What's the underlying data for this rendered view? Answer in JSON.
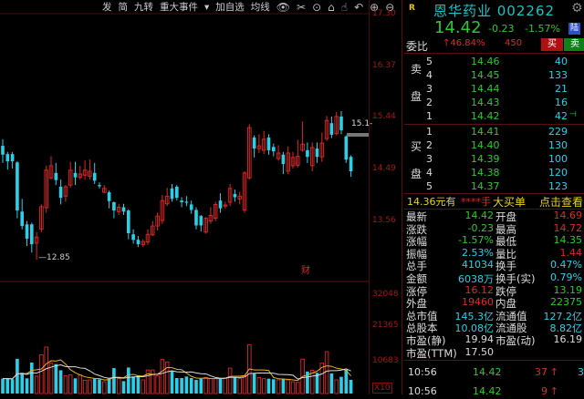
{
  "toolbar": {
    "items": [
      "发",
      "简",
      "九转",
      "重大事件",
      "▾",
      "加自选",
      "均线"
    ],
    "icons": [
      "eye-icon",
      "scissors-icon",
      "play-icon",
      "lock-icon",
      "hand-icon",
      "undo-icon",
      "zoom-in-icon",
      "zoom-out-icon"
    ]
  },
  "chart_data": {
    "type": "candlestick",
    "price_axis": [
      "17.30",
      "16.37",
      "15.44",
      "14.49",
      "13.56"
    ],
    "ylim": [
      12.6,
      17.3
    ],
    "low_label": "12.85",
    "high_label": "15.1-",
    "event_marker": "财",
    "candles": [
      [
        14.91,
        14.75,
        15.03,
        14.6
      ],
      [
        14.76,
        14.63,
        14.8,
        14.48
      ],
      [
        14.76,
        14.63,
        14.8,
        14.5
      ],
      [
        14.61,
        13.74,
        14.63,
        13.6
      ],
      [
        13.72,
        13.46,
        13.95,
        13.4
      ],
      [
        13.49,
        13.23,
        13.55,
        13.1
      ],
      [
        13.49,
        13.13,
        13.52,
        12.98
      ],
      [
        13.15,
        13.26,
        13.35,
        12.85
      ],
      [
        13.4,
        13.81,
        13.85,
        13.35
      ],
      [
        13.79,
        14.47,
        14.55,
        13.7
      ],
      [
        14.33,
        14.55,
        14.72,
        14.3
      ],
      [
        14.42,
        14.29,
        14.6,
        14.2
      ],
      [
        14.17,
        13.97,
        14.3,
        13.85
      ],
      [
        14.0,
        14.17,
        14.2,
        13.9
      ],
      [
        14.2,
        14.47,
        14.62,
        14.15
      ],
      [
        14.42,
        14.34,
        14.62,
        14.2
      ],
      [
        14.34,
        14.4,
        14.55,
        14.3
      ],
      [
        14.38,
        14.47,
        14.65,
        14.3
      ],
      [
        14.36,
        14.45,
        14.66,
        14.3
      ],
      [
        14.42,
        14.28,
        14.6,
        14.22
      ],
      [
        14.2,
        14.18,
        14.25,
        14.14
      ],
      [
        14.07,
        14.14,
        14.2,
        14.05
      ],
      [
        14.07,
        13.91,
        14.1,
        13.78
      ],
      [
        13.89,
        13.74,
        13.9,
        13.6
      ],
      [
        13.72,
        13.8,
        13.86,
        13.66
      ],
      [
        13.8,
        13.72,
        13.86,
        13.66
      ],
      [
        13.74,
        13.33,
        13.76,
        13.22
      ],
      [
        13.31,
        13.21,
        13.4,
        13.14
      ],
      [
        13.21,
        13.13,
        13.28,
        13.08
      ],
      [
        13.12,
        13.18,
        13.22,
        13.08
      ],
      [
        13.17,
        13.31,
        13.4,
        13.12
      ],
      [
        13.3,
        13.46,
        13.55,
        13.28
      ],
      [
        13.46,
        13.64,
        13.7,
        13.38
      ],
      [
        13.56,
        13.92,
        14.02,
        13.5
      ],
      [
        13.86,
        14.0,
        14.15,
        13.82
      ],
      [
        14.14,
        13.95,
        14.22,
        13.9
      ],
      [
        14.17,
        13.97,
        14.2,
        13.92
      ],
      [
        13.92,
        13.89,
        13.98,
        13.8
      ],
      [
        13.9,
        13.88,
        14.0,
        13.82
      ],
      [
        13.85,
        13.75,
        13.92,
        13.68
      ],
      [
        13.75,
        13.47,
        13.8,
        13.4
      ],
      [
        13.64,
        13.47,
        13.66,
        13.36
      ],
      [
        13.35,
        13.6,
        13.62,
        13.32
      ],
      [
        13.55,
        13.65,
        13.8,
        13.5
      ],
      [
        13.6,
        13.85,
        13.9,
        13.55
      ],
      [
        13.92,
        13.78,
        14.05,
        13.7
      ],
      [
        13.82,
        13.84,
        13.9,
        13.78
      ],
      [
        13.89,
        14.14,
        14.22,
        13.82
      ],
      [
        14.04,
        13.98,
        14.12,
        13.9
      ],
      [
        13.95,
        14.0,
        14.08,
        13.85
      ],
      [
        13.75,
        14.42,
        14.45,
        13.7
      ],
      [
        14.33,
        15.24,
        15.3,
        14.3
      ],
      [
        15.06,
        14.86,
        15.1,
        14.7
      ],
      [
        14.86,
        14.91,
        15.12,
        14.78
      ],
      [
        14.83,
        15.03,
        15.18,
        14.76
      ],
      [
        15.06,
        14.83,
        15.12,
        14.75
      ],
      [
        14.89,
        14.81,
        14.95,
        14.72
      ],
      [
        14.68,
        14.78,
        14.92,
        14.64
      ],
      [
        14.75,
        14.58,
        14.8,
        14.4
      ],
      [
        14.45,
        14.78,
        14.9,
        14.4
      ],
      [
        14.55,
        14.7,
        14.8,
        14.5
      ],
      [
        14.56,
        14.72,
        15.02,
        14.52
      ],
      [
        14.83,
        14.94,
        15.35,
        14.8
      ],
      [
        14.83,
        14.71,
        14.97,
        14.6
      ],
      [
        14.55,
        14.88,
        14.97,
        14.45
      ],
      [
        14.86,
        14.71,
        14.97,
        14.6
      ],
      [
        14.71,
        14.96,
        15.15,
        14.62
      ],
      [
        15.04,
        15.37,
        15.45,
        15.0
      ],
      [
        15.32,
        15.11,
        15.44,
        15.05
      ],
      [
        15.13,
        15.44,
        15.52,
        15.1
      ],
      [
        15.44,
        15.19,
        15.54,
        15.12
      ],
      [
        15.08,
        14.66,
        15.1,
        14.6
      ],
      [
        14.71,
        14.45,
        14.74,
        14.35
      ]
    ],
    "volume_axis": [
      "32048",
      "21365",
      "10683",
      "X10"
    ],
    "volume_max": 32048,
    "volumes": [
      4800,
      4800,
      4600,
      11200,
      6700,
      4900,
      10000,
      5600,
      12500,
      15000,
      9800,
      9500,
      7500,
      5700,
      6000,
      4900,
      6000,
      4300,
      4400,
      4800,
      4600,
      3800,
      4800,
      8200,
      4800,
      4000,
      8400,
      5500,
      5900,
      4400,
      7600,
      7600,
      5700,
      11000,
      10200,
      7200,
      5000,
      5000,
      5500,
      5000,
      4400,
      4800,
      5200,
      4800,
      4800,
      4800,
      5000,
      8200,
      5200,
      4800,
      5700,
      15800,
      6500,
      5200,
      4800,
      4800,
      4600,
      4400,
      4800,
      4400,
      3800,
      3600,
      11100,
      7100,
      7500,
      6700,
      9800,
      13500,
      6500,
      4400,
      5400,
      7700,
      4400
    ],
    "colors": {
      "up": "#e02828",
      "down": "#2ad0e8"
    }
  },
  "quote": {
    "r_mark": "R",
    "title": "恩华药业 002262",
    "price": "14.42",
    "change": "-0.23",
    "change_pct": "-1.57%",
    "lu_badge": "陆",
    "weibi_label": "委比",
    "weibi_pct": "↑46.84%",
    "weibi_diff": "450",
    "buy_btn": "买",
    "sell_btn": "卖",
    "sell_side_labels": [
      "卖",
      "盘"
    ],
    "buy_side_labels": [
      "买",
      "盘"
    ],
    "sell_levels": [
      {
        "level": "5",
        "price": "14.46",
        "vol": "40"
      },
      {
        "level": "4",
        "price": "14.45",
        "vol": "133"
      },
      {
        "level": "3",
        "price": "14.44",
        "vol": "21"
      },
      {
        "level": "2",
        "price": "14.43",
        "vol": "16"
      },
      {
        "level": "1",
        "price": "14.42",
        "vol": "42"
      }
    ],
    "buy_levels": [
      {
        "level": "1",
        "price": "14.41",
        "vol": "229"
      },
      {
        "level": "2",
        "price": "14.40",
        "vol": "130"
      },
      {
        "level": "3",
        "price": "14.39",
        "vol": "100"
      },
      {
        "level": "4",
        "price": "14.38",
        "vol": "120"
      },
      {
        "level": "5",
        "price": "14.37",
        "vol": "123"
      }
    ],
    "big_order": {
      "price_text": "14.36元有",
      "qty": "****手",
      "label": "大买单",
      "link": "点击查看"
    },
    "stats": [
      {
        "l": "最新",
        "v": "14.42",
        "l2": "开盘",
        "v2": "14.69",
        "c": "g",
        "c2": "rd"
      },
      {
        "l": "涨跌",
        "v": "-0.23",
        "l2": "最高",
        "v2": "14.72",
        "c": "g",
        "c2": "rd"
      },
      {
        "l": "涨幅",
        "v": "-1.57%",
        "l2": "最低",
        "v2": "14.35",
        "c": "g",
        "c2": "g"
      },
      {
        "l": "振幅",
        "v": "2.53%",
        "l2": "量比",
        "v2": "1.44",
        "c": "cy",
        "c2": "rd"
      },
      {
        "l": "总手",
        "v": "41034",
        "l2": "换手",
        "v2": "0.47%",
        "c": "cy",
        "c2": "cy"
      },
      {
        "l": "金额",
        "v": "6038万",
        "l2": "换手(实)",
        "v2": "0.79%",
        "c": "cy",
        "c2": "cy"
      },
      {
        "l": "涨停",
        "v": "16.12",
        "l2": "跌停",
        "v2": "13.19",
        "c": "rd",
        "c2": "g"
      },
      {
        "l": "外盘",
        "v": "19460",
        "l2": "内盘",
        "v2": "22375",
        "c": "rd",
        "c2": "g"
      },
      {
        "l": "总市值",
        "v": "145.3亿",
        "l2": "流通值",
        "v2": "127.2亿",
        "c": "cy",
        "c2": "cy"
      },
      {
        "l": "总股本",
        "v": "10.08亿",
        "l2": "流通股",
        "v2": "8.82亿",
        "c": "cy",
        "c2": "cy"
      },
      {
        "l": "市盈(静)",
        "v": "19.94",
        "l2": "市盈(动)",
        "v2": "16.19",
        "c": "wh",
        "c2": "wh"
      },
      {
        "l": "市盈(TTM)",
        "v": "17.50",
        "l2": "",
        "v2": "",
        "c": "wh",
        "c2": "wh"
      }
    ],
    "ticks": [
      {
        "time": "10:56",
        "price": "14.42",
        "vol": "37",
        "arrow": "↑",
        "extra": "3"
      },
      {
        "time": "10:56",
        "price": "14.42",
        "vol": "9",
        "arrow": "↑",
        "extra": ""
      }
    ]
  }
}
